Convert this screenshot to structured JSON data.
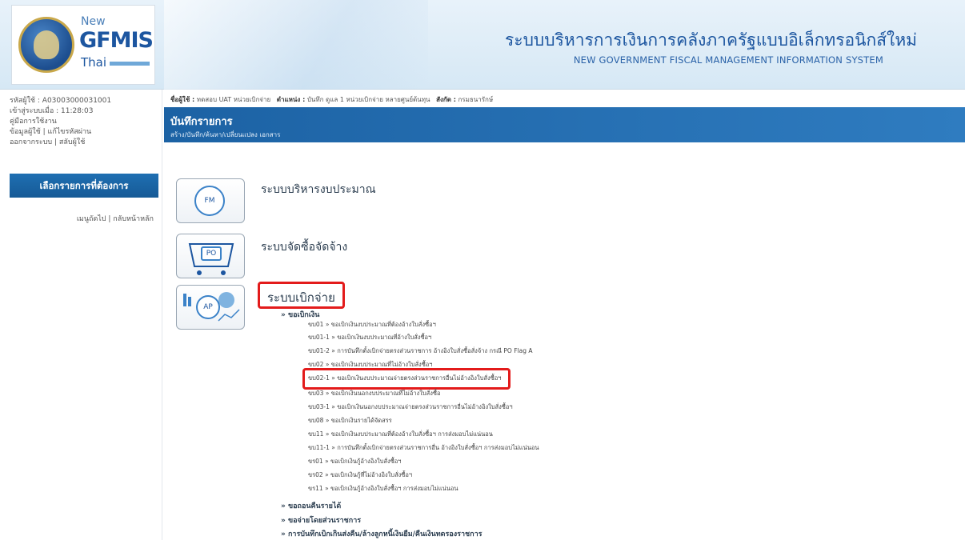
{
  "header": {
    "logo_new": "New",
    "logo_main": "GFMIS",
    "logo_thai": "Thai",
    "title_th": "ระบบบริหารการเงินการคลังภาครัฐแบบอิเล็กทรอนิกส์ใหม่",
    "title_en": "NEW GOVERNMENT FISCAL MANAGEMENT INFORMATION SYSTEM"
  },
  "sidebar": {
    "user_id": "รหัสผู้ใช้ : A03003000031001",
    "login_time": "เข้าสู่ระบบเมื่อ : 11:28:03",
    "manual": "คู่มือการใช้งาน",
    "profile_links": "ข้อมูลผู้ใช้ | แก้ไขรหัสผ่าน",
    "logout_links": "ออกจากระบบ | สลับผู้ใช้",
    "menu_button": "เลือกรายการที่ต้องการ",
    "nav_links": "เมนูถัดไป | กลับหน้าหลัก"
  },
  "topinfo": {
    "user_label": "ชื่อผู้ใช้ :",
    "user_value": "ทดสอบ UAT หน่วยเบิกจ่าย",
    "position_label": "ตำแหน่ง :",
    "position_value": "บันทึก ดูแล 1 หน่วยเบิกจ่าย หลายศูนย์ต้นทุน",
    "affiliation_label": "สังกัด :",
    "affiliation_value": "กรมธนารักษ์"
  },
  "titlebar": {
    "title": "บันทึกรายการ",
    "subtitle": "สร้าง/บันทึก/ค้นหา/เปลี่ยนแปลง เอกสาร"
  },
  "modules": {
    "fm": {
      "badge": "FM",
      "title": "ระบบบริหารงบประมาณ",
      "icon": "fm-budget-icon"
    },
    "po": {
      "badge": "PO",
      "title": "ระบบจัดซื้อจัดจ้าง",
      "icon": "po-cart-icon"
    },
    "ap": {
      "badge": "AP",
      "title": "ระบบเบิกจ่าย",
      "icon": "ap-chart-icon"
    }
  },
  "ap_menu": {
    "section": "» ขอเบิกเงิน",
    "items": [
      "ขบ01 » ขอเบิกเงินงบประมาณที่ต้องอ้างใบสั่งซื้อฯ",
      "ขบ01-1 » ขอเบิกเงินงบประมาณที่อ้างใบสั่งซื้อฯ",
      "ขบ01-2 » การบันทึกตั้งเบิกจ่ายตรงส่วนราชการ อ้างอิงใบสั่งซื้อสั่งจ้าง กรณี PO Flag A",
      "ขบ02 » ขอเบิกเงินงบประมาณที่ไม่อ้างใบสั่งซื้อฯ",
      "ขบ02-1 » ขอเบิกเงินงบประมาณจ่ายตรงส่วนราชการอื่นไม่อ้างอิงใบสั่งซื้อฯ",
      "ขบ03 » ขอเบิกเงินนอกงบประมาณที่ไม่อ้างใบสั่งซื้อ",
      "ขบ03-1 » ขอเบิกเงินนอกงบประมาณจ่ายตรงส่วนราชการอื่นไม่อ้างอิงใบสั่งซื้อฯ",
      "ขบ08 » ขอเบิกเงินรายได้จัดสรร",
      "ขบ11 » ขอเบิกเงินงบประมาณที่ต้องอ้างใบสั่งซื้อฯ การส่งมอบไม่แน่นอน",
      "ขบ11-1 » การบันทึกตั้งเบิกจ่ายตรงส่วนราชการอื่น อ้างอิงใบสั่งซื้อฯ การส่งมอบไม่แน่นอน",
      "ขร01 » ขอเบิกเงินกู้อ้างอิงใบสั่งซื้อฯ",
      "ขร02 » ขอเบิกเงินกู้ที่ไม่อ้างอิงใบสั่งซื้อฯ",
      "ขร11 » ขอเบิกเงินกู้อ้างอิงใบสั่งซื้อฯ การส่งมอบไม่แน่นอน"
    ],
    "footer": [
      "» ขอถอนคืนรายได้",
      "» ขอจ่ายโดยส่วนราชการ",
      "» การบันทึกเบิกเกินส่งคืน/ล้างลูกหนี้เงินยืม/คืนเงินทดรองราชการ"
    ]
  },
  "colors": {
    "accent": "#1c62a4",
    "highlight": "#e31b1b"
  }
}
